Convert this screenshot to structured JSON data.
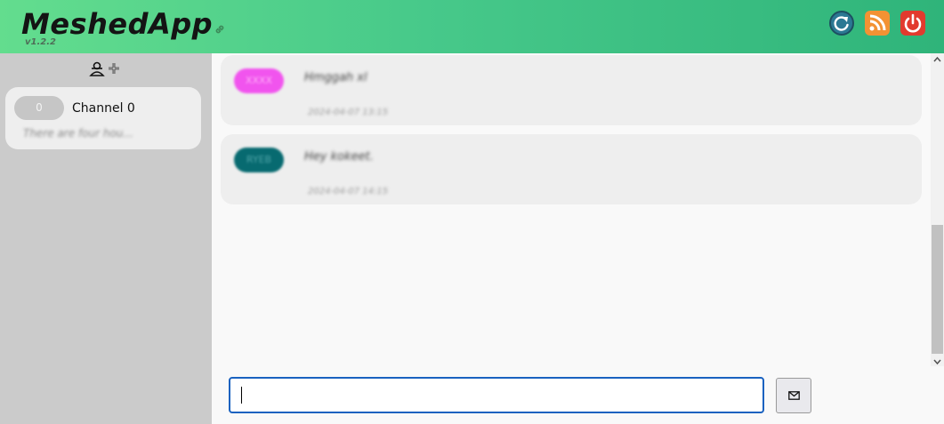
{
  "header": {
    "title": "MeshedApp",
    "version": "v1.2.2",
    "icons": [
      "link-icon",
      "refresh-icon",
      "rss-icon",
      "power-icon"
    ],
    "colors": {
      "refresh": "#2b7893",
      "rss": "#f39233",
      "power": "#e23a2e"
    }
  },
  "sidebar": {
    "add_icon": "add-user-icon",
    "channels": [
      {
        "count": "0",
        "name": "Channel 0",
        "preview": "There are four hou..."
      }
    ]
  },
  "messages": [
    {
      "sender": "XXXX",
      "text": "Hmggah xl",
      "time": "2024-04-07 13:15",
      "color": "#f154ee"
    },
    {
      "sender": "RYEB",
      "text": "Hey kokeet.",
      "time": "2024-04-07 14:15",
      "color": "#076a70"
    }
  ],
  "compose": {
    "value": "",
    "send_icon": "envelope-icon"
  }
}
